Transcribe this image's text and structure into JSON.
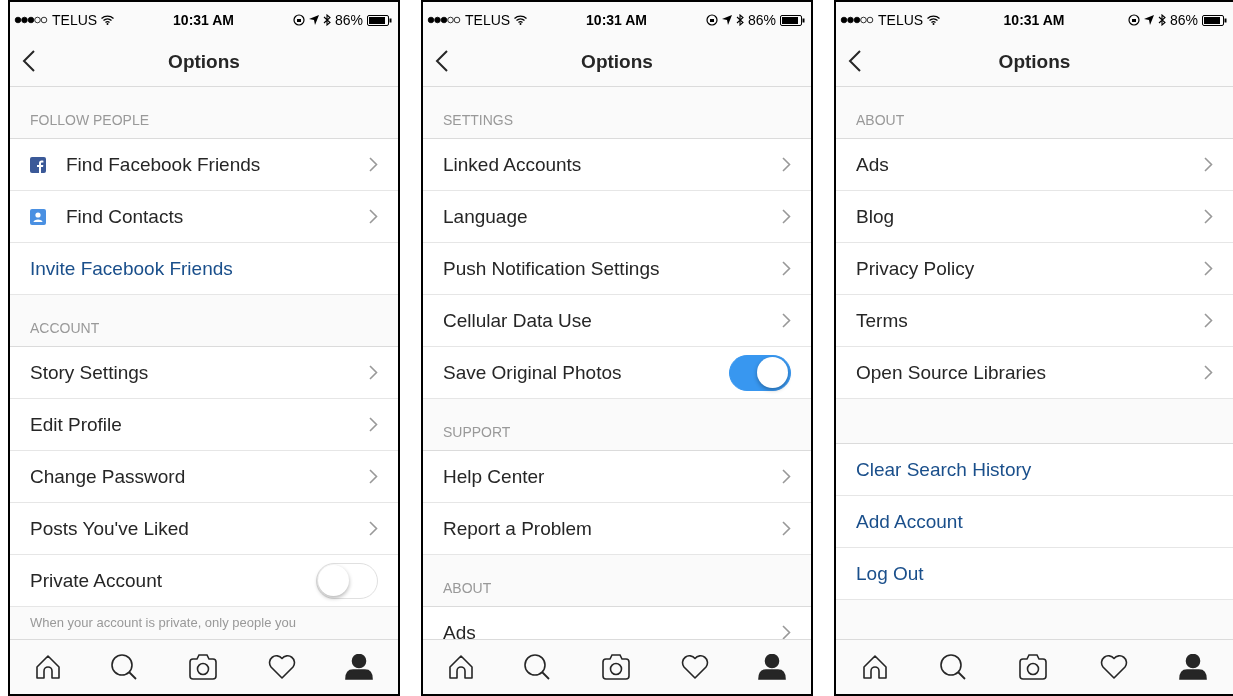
{
  "phones": [
    {
      "status": {
        "carrier": "TELUS",
        "time": "10:31 AM",
        "battery": "86%"
      },
      "title": "Options",
      "sections": [
        {
          "header": "FOLLOW PEOPLE",
          "items": [
            {
              "kind": "badge-f",
              "label": "Find Facebook Friends"
            },
            {
              "kind": "badge-person",
              "label": "Find Contacts"
            },
            {
              "kind": "link",
              "label": "Invite Facebook Friends"
            }
          ]
        },
        {
          "header": "ACCOUNT",
          "items": [
            {
              "kind": "nav",
              "label": "Story Settings"
            },
            {
              "kind": "nav",
              "label": "Edit Profile"
            },
            {
              "kind": "nav",
              "label": "Change Password"
            },
            {
              "kind": "nav",
              "label": "Posts You've Liked"
            },
            {
              "kind": "toggle",
              "label": "Private Account",
              "on": false
            },
            {
              "kind": "note",
              "label": "When your account is private, only people you"
            }
          ]
        }
      ],
      "tabs": [
        {
          "selected": false
        },
        {
          "selected": false
        },
        {
          "selected": false
        },
        {
          "selected": false
        },
        {
          "selected": true
        }
      ]
    },
    {
      "status": {
        "carrier": "TELUS",
        "time": "10:31 AM",
        "battery": "86%"
      },
      "title": "Options",
      "sections": [
        {
          "header": "SETTINGS",
          "items": [
            {
              "kind": "nav",
              "label": "Linked Accounts"
            },
            {
              "kind": "nav",
              "label": "Language"
            },
            {
              "kind": "nav",
              "label": "Push Notification Settings"
            },
            {
              "kind": "nav",
              "label": "Cellular Data Use"
            },
            {
              "kind": "toggle",
              "label": "Save Original Photos",
              "on": true
            }
          ]
        },
        {
          "header": "SUPPORT",
          "items": [
            {
              "kind": "nav",
              "label": "Help Center"
            },
            {
              "kind": "nav",
              "label": "Report a Problem"
            }
          ]
        },
        {
          "header": "ABOUT",
          "items": [
            {
              "kind": "nav",
              "label": "Ads"
            }
          ]
        }
      ],
      "tabs": [
        {
          "selected": false
        },
        {
          "selected": false
        },
        {
          "selected": false
        },
        {
          "selected": false
        },
        {
          "selected": true
        }
      ]
    },
    {
      "status": {
        "carrier": "TELUS",
        "time": "10:31 AM",
        "battery": "86%"
      },
      "title": "Options",
      "sections": [
        {
          "header": "ABOUT",
          "items": [
            {
              "kind": "nav",
              "label": "Ads"
            },
            {
              "kind": "nav",
              "label": "Blog"
            },
            {
              "kind": "nav",
              "label": "Privacy Policy"
            },
            {
              "kind": "nav",
              "label": "Terms"
            },
            {
              "kind": "nav",
              "label": "Open Source Libraries"
            }
          ]
        },
        {
          "items": [
            {
              "kind": "link",
              "label": "Clear Search History"
            },
            {
              "kind": "link",
              "label": "Add Account"
            },
            {
              "kind": "link",
              "label": "Log Out"
            }
          ]
        }
      ],
      "tabs": [
        {
          "selected": false
        },
        {
          "selected": false
        },
        {
          "selected": false
        },
        {
          "selected": false
        },
        {
          "selected": true
        }
      ]
    }
  ]
}
